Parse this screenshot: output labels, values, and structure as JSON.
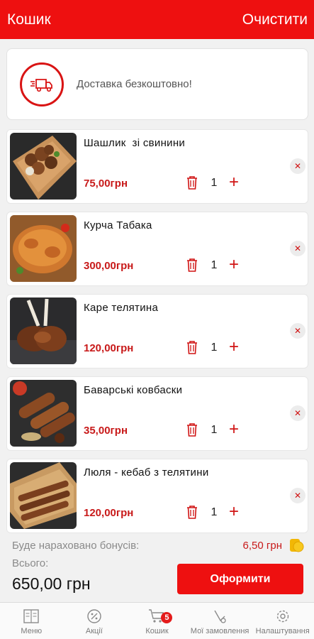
{
  "header": {
    "title": "Кошик",
    "clear_label": "Очистити"
  },
  "delivery": {
    "icon": "delivery-truck-icon",
    "text": "Доставка безкоштовно!"
  },
  "cart": {
    "items": [
      {
        "name": "Шашлик  зі свинини",
        "price": "75,00грн",
        "quantity": "1",
        "image": "pork-shashlik-photo"
      },
      {
        "name": "Курча Табака",
        "price": "300,00грн",
        "quantity": "1",
        "image": "chicken-tabaka-photo"
      },
      {
        "name": "Каре телятина",
        "price": "120,00грн",
        "quantity": "1",
        "image": "veal-rack-photo"
      },
      {
        "name": "Баварські ковбаски",
        "price": "35,00грн",
        "quantity": "1",
        "image": "bavarian-sausages-photo"
      },
      {
        "name": "Люля - кебаб з телятини",
        "price": "120,00грн",
        "quantity": "1",
        "image": "veal-lula-kebab-photo"
      }
    ]
  },
  "summary": {
    "bonus_label": "Буде нараховано бонусів:",
    "bonus_value": "6,50 грн",
    "total_label": "Всього:",
    "total_value": "650,00 грн",
    "checkout_label": "Оформити"
  },
  "tabbar": {
    "tabs": [
      {
        "label": "Меню",
        "icon": "menu-book-icon"
      },
      {
        "label": "Акції",
        "icon": "percent-icon"
      },
      {
        "label": "Кошик",
        "icon": "cart-icon",
        "badge": "5"
      },
      {
        "label": "Мої замовлення",
        "icon": "orders-icon"
      },
      {
        "label": "Налаштування",
        "icon": "gear-icon"
      }
    ]
  },
  "colors": {
    "accent": "#ee1010",
    "price": "#c81a1a",
    "background": "#f1f1f1"
  }
}
